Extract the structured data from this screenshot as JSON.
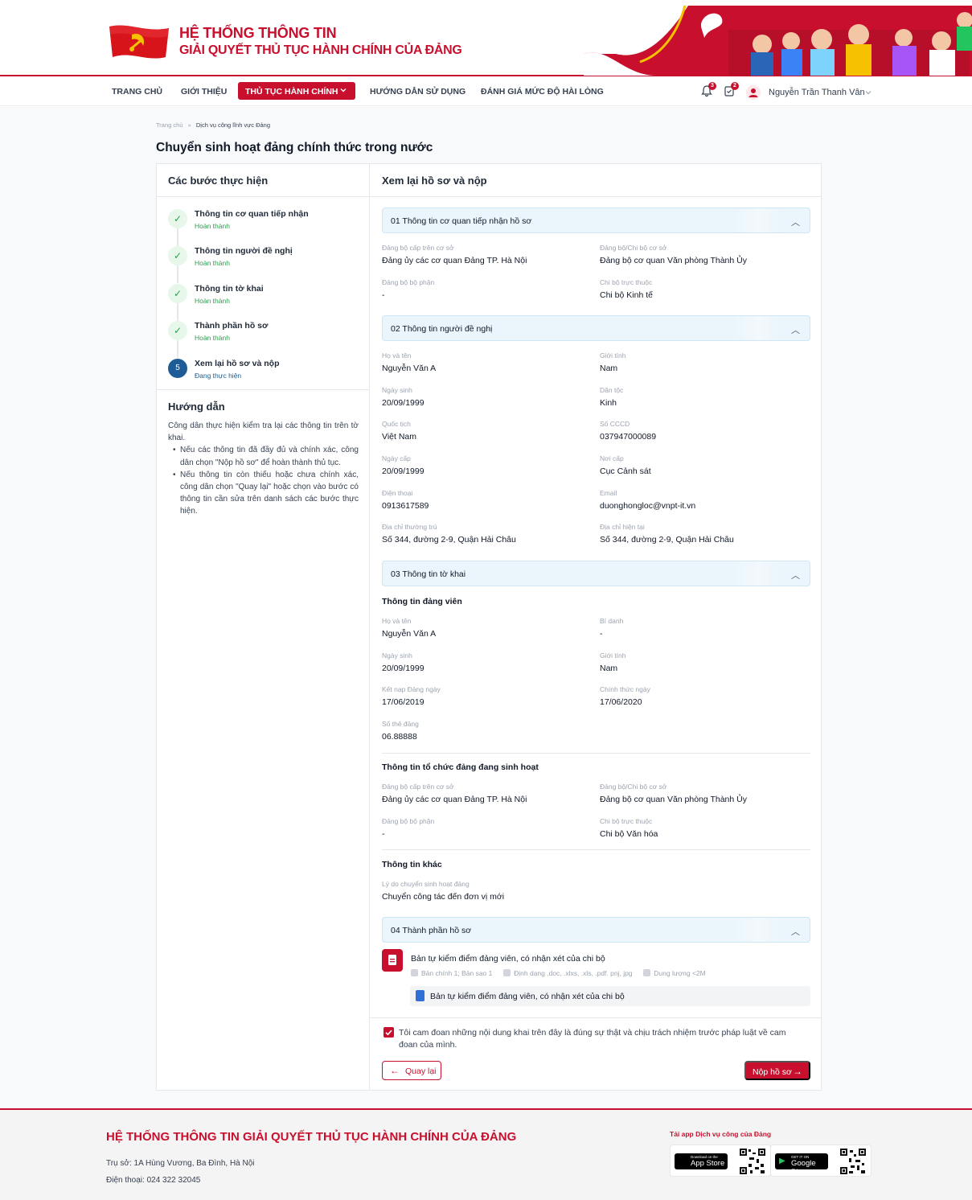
{
  "header": {
    "title_line1": "HỆ THỐNG THÔNG TIN",
    "title_line2": "GIẢI QUYẾT THỦ TỤC HÀNH CHÍNH CỦA ĐẢNG"
  },
  "nav": {
    "items": [
      "TRANG CHỦ",
      "GIỚI THIỆU",
      "THỦ TỤC HÀNH CHÍNH",
      "HƯỚNG DẪN SỬ DỤNG",
      "ĐÁNH GIÁ MỨC ĐỘ HÀI LÒNG"
    ],
    "notif_count": "3",
    "task_count": "2",
    "user_name": "Nguyễn Trần Thanh Vân"
  },
  "breadcrumb": {
    "home": "Trang chủ",
    "sep": "»",
    "current": "Dịch vụ công lĩnh vực Đảng"
  },
  "page_title": "Chuyển sinh hoạt đảng chính thức trong nước",
  "steps": {
    "title": "Các bước thực hiện",
    "items": [
      {
        "title": "Thông tin cơ quan tiếp nhận",
        "status": "Hoàn thành",
        "mark": "✓"
      },
      {
        "title": "Thông tin người đề nghị",
        "status": "Hoàn thành",
        "mark": "✓"
      },
      {
        "title": "Thông tin tờ khai",
        "status": "Hoàn thành",
        "mark": "✓"
      },
      {
        "title": "Thành phần hồ sơ",
        "status": "Hoàn thành",
        "mark": "✓"
      },
      {
        "title": "Xem lại hồ sơ và nộp",
        "status": "Đang thực hiện",
        "mark": "5"
      }
    ]
  },
  "guide": {
    "title": "Hướng dẫn",
    "intro": "Công dân thực hiện kiểm tra lại các thông tin trên tờ khai.",
    "bullets": [
      "Nếu các thông tin đã đầy đủ và chính xác, công dân chọn \"Nộp hồ sơ\" để hoàn thành thủ tục.",
      "Nếu thông tin còn thiếu hoặc chưa chính xác, công dân chọn \"Quay lại\" hoặc chọn vào bước có thông tin cần sửa trên danh sách các bước thực hiện."
    ]
  },
  "review": {
    "title": "Xem lại hồ sơ và nộp",
    "sec1": {
      "title": "01  Thông tin cơ quan tiếp nhận hồ sơ",
      "f1_label": "Đảng bộ cấp trên cơ sở",
      "f1_value": "Đảng ủy các cơ quan Đảng TP. Hà Nội",
      "f2_label": "Đảng bộ/Chi bộ cơ sở",
      "f2_value": "Đảng bộ cơ quan Văn phòng Thành Ủy",
      "f3_label": "Đảng bộ bộ phận",
      "f3_value": "-",
      "f4_label": "Chi bộ trực thuộc",
      "f4_value": "Chi bộ Kinh tế"
    },
    "sec2": {
      "title": "02  Thông tin người đề nghị",
      "name_label": "Họ và tên",
      "name": "Nguyễn Văn A",
      "gender_label": "Giới tính",
      "gender": "Nam",
      "dob_label": "Ngày sinh",
      "dob": "20/09/1999",
      "ethnic_label": "Dân tộc",
      "ethnic": "Kinh",
      "nation_label": "Quốc tịch",
      "nation": "Việt Nam",
      "id_label": "Số CCCD",
      "id": "037947000089",
      "issue_label": "Ngày cấp",
      "issue": "20/09/1999",
      "place_label": "Nơi cấp",
      "place": "Cục Cảnh sát",
      "phone_label": "Điện thoại",
      "phone": "0913617589",
      "email_label": "Email",
      "email": "duonghongloc@vnpt-it.vn",
      "perm_label": "Địa chỉ thường trú",
      "perm": "Số 344, đường 2-9, Quận Hải Châu",
      "curr_label": "Địa chỉ hiện tại",
      "curr": "Số 344, đường 2-9, Quận Hải Châu"
    },
    "sec3": {
      "title": "03  Thông tin tờ khai",
      "member_h": "Thông tin đảng viên",
      "name_label": "Họ và tên",
      "name": "Nguyễn Văn A",
      "alias_label": "Bí danh",
      "alias": "-",
      "dob_label": "Ngày sinh",
      "dob": "20/09/1999",
      "gender_label": "Giới tính",
      "gender": "Nam",
      "join_label": "Kết nạp Đảng ngày",
      "join": "17/06/2019",
      "official_label": "Chính thức ngày",
      "official": "17/06/2020",
      "card_label": "Số thẻ đảng",
      "card": "06.88888",
      "org_h": "Thông tin tổ chức đảng đang sinh hoạt",
      "o1_label": "Đảng bộ cấp trên cơ sở",
      "o1": "Đảng ủy các cơ quan Đảng TP. Hà Nội",
      "o2_label": "Đảng bộ/Chi bộ cơ sở",
      "o2": "Đảng bộ cơ quan Văn phòng Thành Ủy",
      "o3_label": "Đảng bộ bộ phận",
      "o3": "-",
      "o4_label": "Chi bộ trực thuộc",
      "o4": "Chi bộ Văn hóa",
      "other_h": "Thông tin khác",
      "reason_label": "Lý do chuyển sinh hoạt đảng",
      "reason": "Chuyển công tác đến đơn vị mới"
    },
    "sec4": {
      "title": "04  Thành phần hồ sơ",
      "doc_title": "Bản tự kiểm điểm đảng viên, có nhận xét của chi bộ",
      "meta_copies": "Bản chính 1; Bản sao 1",
      "meta_format": "Định dạng .doc, .xlxs, .xls, .pdf. pnj, jpg",
      "meta_size": "Dung lượng <2M",
      "file_name": "Bản tự kiểm điểm đảng viên, có nhận xét của chi bộ"
    },
    "pledge": "Tôi cam đoan những nội dung khai trên đây là đúng sự thật và chịu trách nhiệm trước pháp luật về cam đoan của mình.",
    "back_label": "Quay lại",
    "submit_label": "Nộp hồ sơ"
  },
  "footer": {
    "title": "HỆ THỐNG THÔNG TIN GIẢI QUYẾT THỦ TỤC HÀNH CHÍNH CỦA ĐẢNG",
    "address": "Trụ sở: 1A Hùng Vương, Ba Đình, Hà Nội",
    "phone": "Điện thoại: 024 322 32045",
    "app_label": "Tải app Dịch vụ công của Đảng",
    "appstore_small": "Download on the",
    "appstore_big": "App Store",
    "gplay_small": "GET IT ON",
    "gplay_big": "Google Play"
  },
  "colors": {
    "brand": "#c8102e",
    "step_done": "#2e9e4f",
    "step_current": "#1d5c96"
  }
}
